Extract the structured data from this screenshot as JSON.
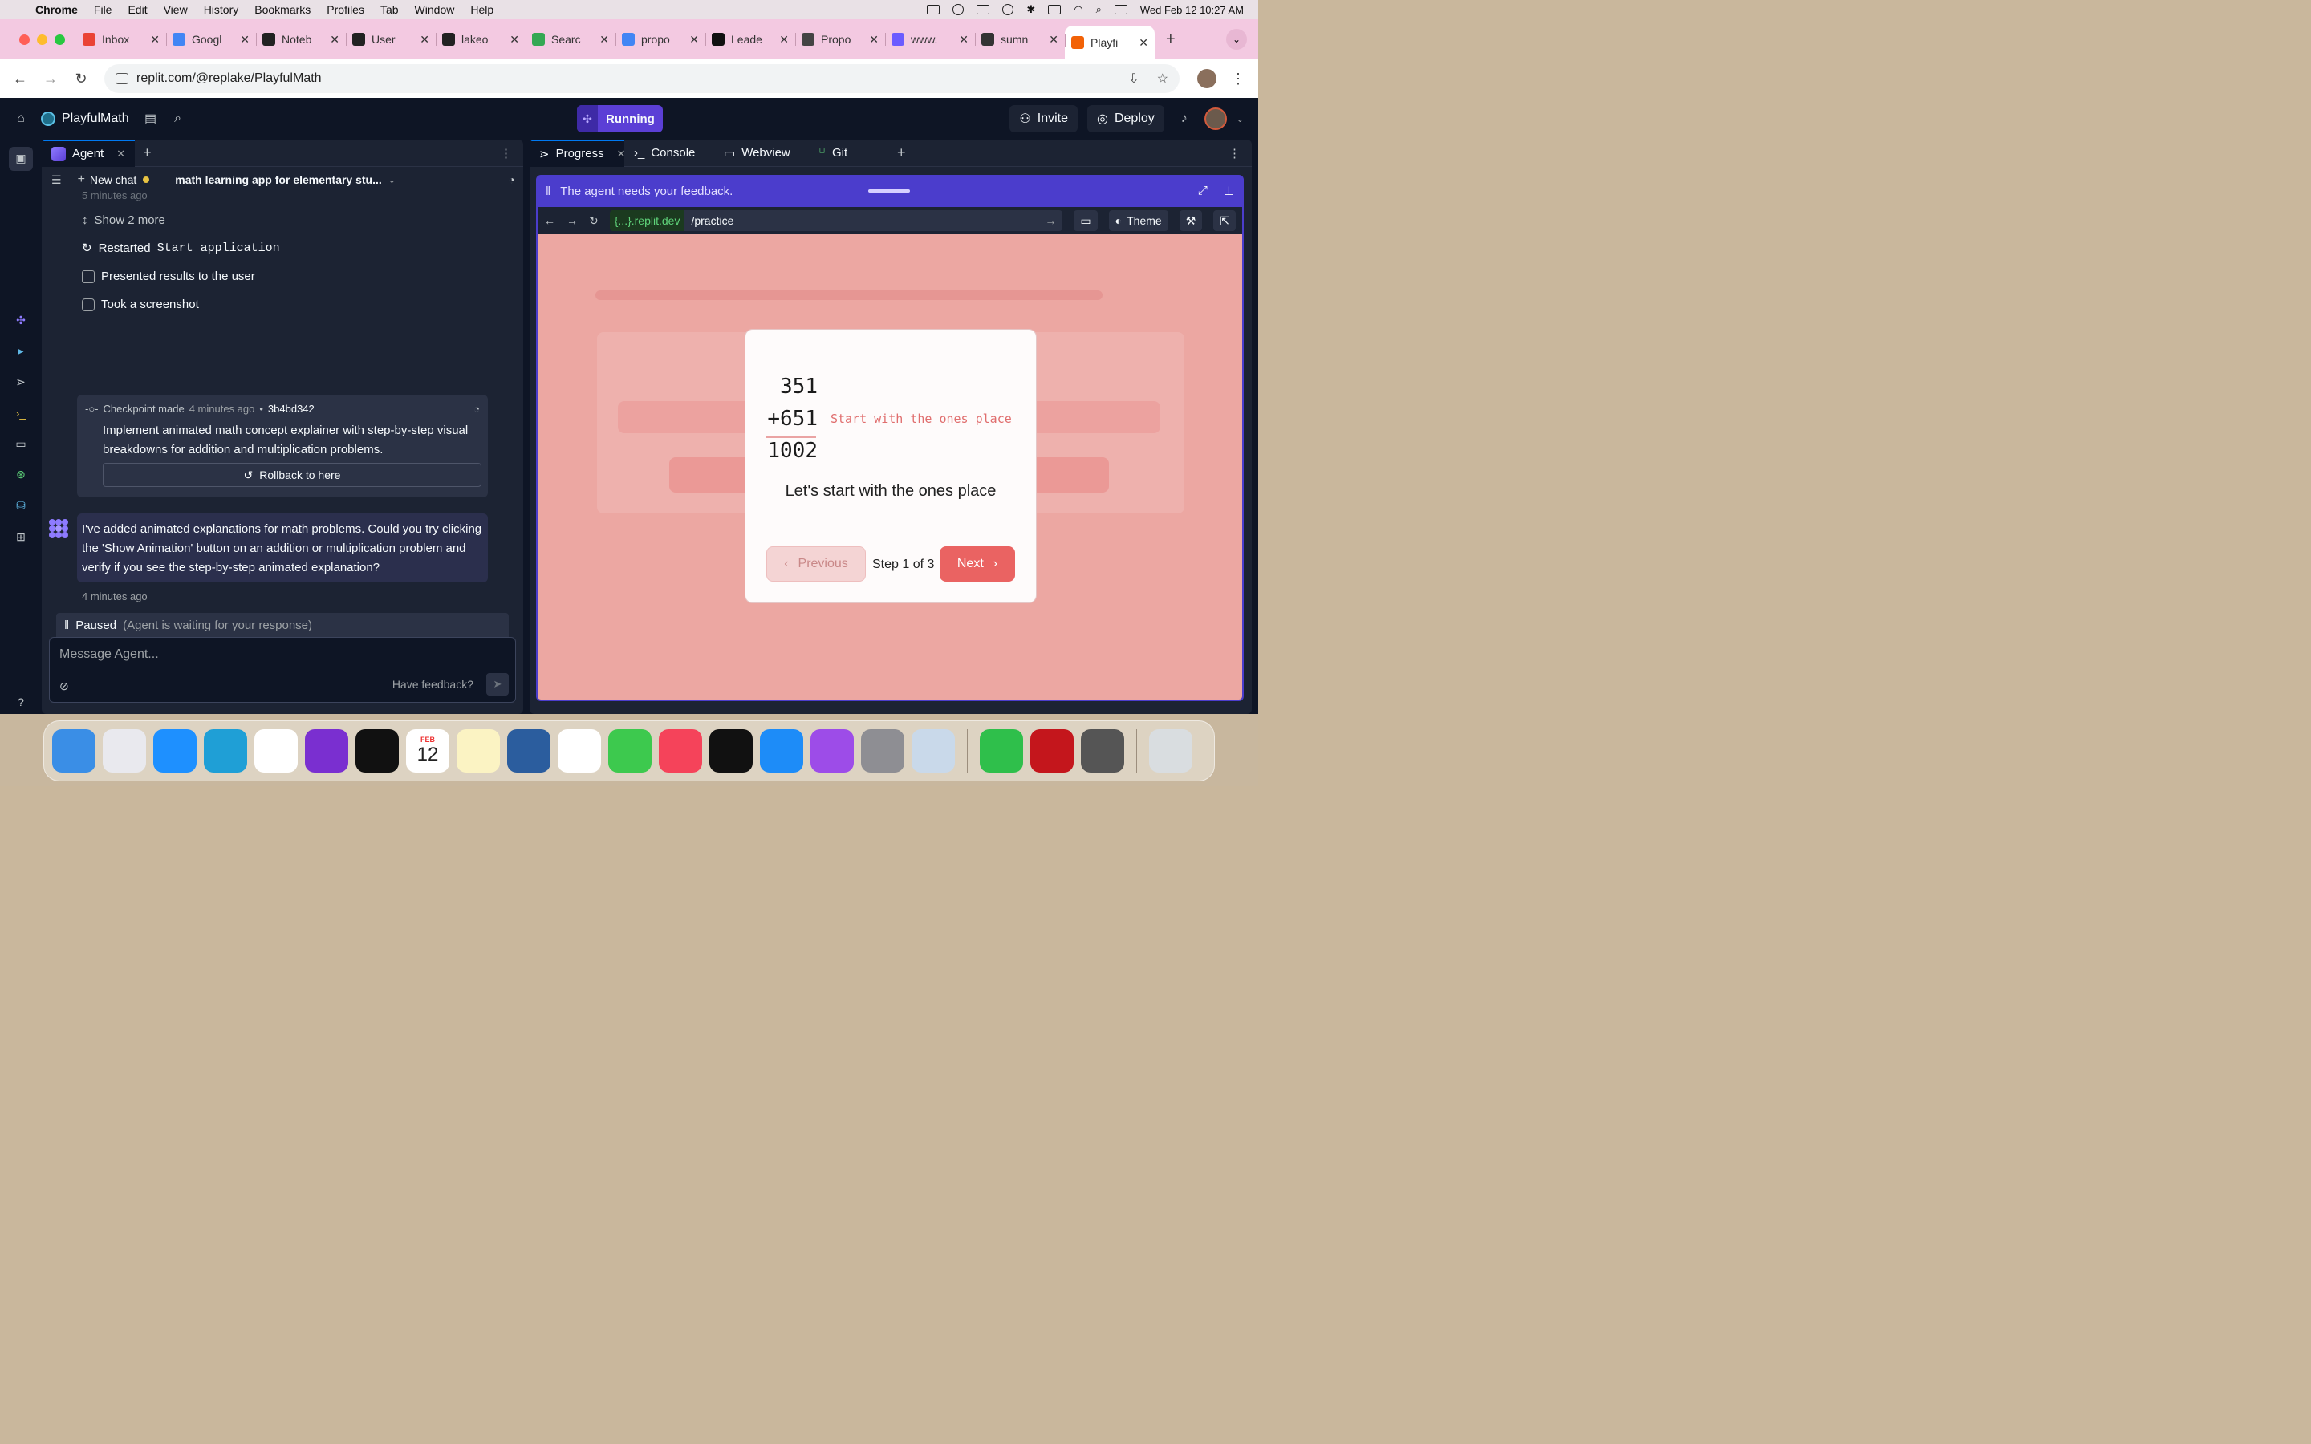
{
  "menubar": {
    "app": "Chrome",
    "items": [
      "File",
      "Edit",
      "View",
      "History",
      "Bookmarks",
      "Profiles",
      "Tab",
      "Window",
      "Help"
    ],
    "datetime": "Wed Feb 12  10:27 AM"
  },
  "tabs": [
    {
      "label": "Inbox",
      "color": "#ea4335"
    },
    {
      "label": "Googl",
      "color": "#4285f4"
    },
    {
      "label": "Noteb",
      "color": "#222222"
    },
    {
      "label": "User",
      "color": "#222222"
    },
    {
      "label": "lakeo",
      "color": "#222222"
    },
    {
      "label": "Searc",
      "color": "#34a853"
    },
    {
      "label": "propo",
      "color": "#4285f4"
    },
    {
      "label": "Leade",
      "color": "#111111"
    },
    {
      "label": "Propo",
      "color": "#444444"
    },
    {
      "label": "www.",
      "color": "#6b5bff"
    },
    {
      "label": "sumn",
      "color": "#333333"
    },
    {
      "label": "Playfi",
      "color": "#f26207",
      "active": true
    }
  ],
  "address": {
    "url": "replit.com/@replake/PlayfulMath"
  },
  "app": {
    "project_name": "PlayfulMath",
    "status": "Running",
    "invite_label": "Invite",
    "deploy_label": "Deploy"
  },
  "left_pane": {
    "tab_label": "Agent",
    "new_chat_label": "New chat",
    "chat_title": "math learning app for elementary stu...",
    "top_timestamp": "5 minutes ago",
    "show_more": "Show 2 more",
    "actions": {
      "restarted_prefix": "Restarted",
      "restarted_code": "Start application",
      "presented": "Presented results to the user",
      "screenshot": "Took a screenshot"
    },
    "checkpoint": {
      "label": "Checkpoint made",
      "time": "4 minutes ago",
      "sep": "•",
      "hash": "3b4bd342",
      "description": "Implement animated math concept explainer with step-by-step visual breakdowns for addition and multiplication problems.",
      "rollback_label": "Rollback to here"
    },
    "agent_message": "I've added animated explanations for math problems. Could you try clicking the 'Show Animation' button on an addition or multiplication problem and verify if you see the step-by-step animated explanation?",
    "message_time": "4 minutes ago",
    "paused_label": "Paused",
    "paused_sub": "(Agent is waiting for your response)",
    "input_placeholder": "Message Agent...",
    "feedback_label": "Have feedback?"
  },
  "right_pane": {
    "tabs": [
      "Progress",
      "Console",
      "Webview",
      "Git"
    ],
    "feedback_text": "The agent needs your feedback.",
    "webview": {
      "domain": "{...}.replit.dev",
      "path": "/practice",
      "theme_label": "Theme"
    },
    "modal": {
      "operand1": "351",
      "operand2": "+651",
      "result": "1002",
      "hint": "Start with the ones place",
      "explanation": "Let's start with the ones place",
      "prev_label": "Previous",
      "step_label": "Step 1 of 3",
      "next_label": "Next"
    }
  },
  "dock": {
    "calendar_month": "FEB",
    "calendar_day": "12",
    "apps": [
      {
        "name": "finder",
        "color": "#3a8ee6"
      },
      {
        "name": "launchpad",
        "color": "#e9e9ee"
      },
      {
        "name": "safari",
        "color": "#1e90ff"
      },
      {
        "name": "edge",
        "color": "#1f9fd6"
      },
      {
        "name": "chrome",
        "color": "#ffffff"
      },
      {
        "name": "firefox",
        "color": "#7a2fd0"
      },
      {
        "name": "screenshot",
        "color": "#111111"
      },
      {
        "name": "calendar",
        "color": "#ffffff"
      },
      {
        "name": "notes",
        "color": "#fbf3c3"
      },
      {
        "name": "codex",
        "color": "#2b5d9e"
      },
      {
        "name": "photos",
        "color": "#ffffff"
      },
      {
        "name": "messages",
        "color": "#3dc94e"
      },
      {
        "name": "music",
        "color": "#f5435a"
      },
      {
        "name": "tv",
        "color": "#111111"
      },
      {
        "name": "app-store",
        "color": "#1d8cf8"
      },
      {
        "name": "podcasts",
        "color": "#9d4ce8"
      },
      {
        "name": "settings",
        "color": "#8e8e93"
      },
      {
        "name": "preview",
        "color": "#c9d9ea"
      },
      {
        "name": "numbers",
        "color": "#2fbf4b"
      },
      {
        "name": "acrobat",
        "color": "#c4161c"
      },
      {
        "name": "image-capture",
        "color": "#555555"
      },
      {
        "name": "trash",
        "color": "#d9dde0"
      }
    ]
  }
}
